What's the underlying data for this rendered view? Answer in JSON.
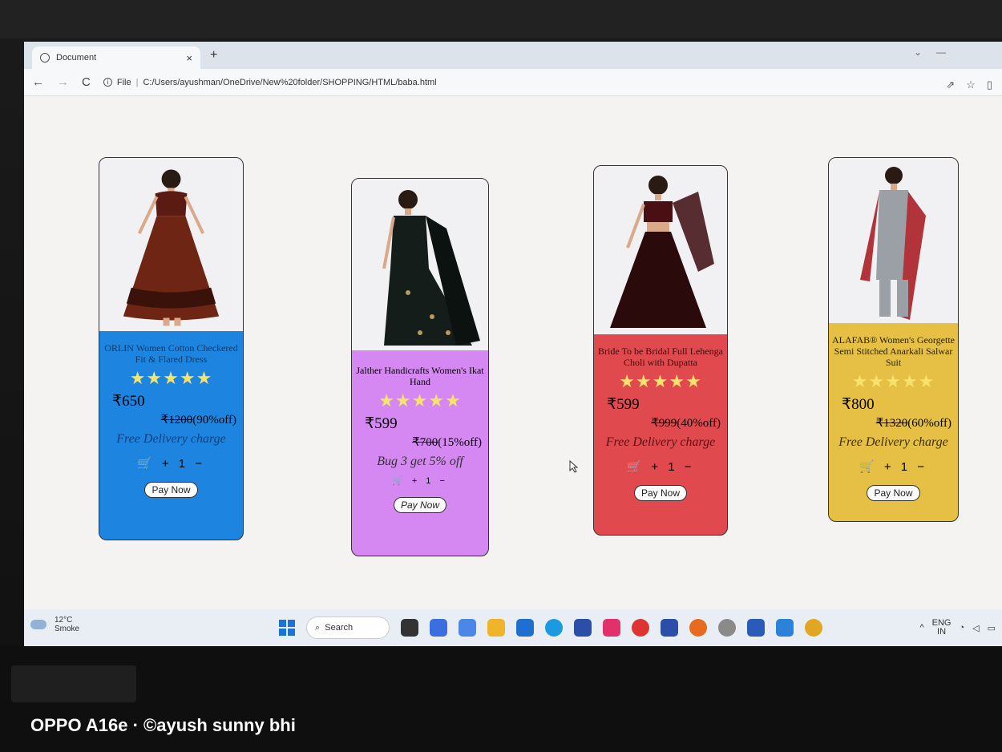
{
  "browser": {
    "tab_title": "Document",
    "tab_close": "×",
    "new_tab": "+",
    "nav": {
      "back": "←",
      "forward": "→",
      "reload": "C"
    },
    "url_prefix": "File",
    "url_sep": "|",
    "url": "C:/Users/ayushman/OneDrive/New%20folder/SHOPPING/HTML/baba.html",
    "actions": [
      "⇗",
      "☆",
      "▯"
    ]
  },
  "products": [
    {
      "name": "ORLIN Women Cotton Checkered Fit & Flared Dress",
      "stars": "★★★★★",
      "price": "₹650",
      "mrp": "₹1200",
      "off": "(90%off)",
      "note": "Free Delivery charge",
      "cart": "🛒 + 1 −",
      "pay": "Pay Now",
      "color": "#1d84e0",
      "image_icon": "flared-dress-icon"
    },
    {
      "name": "Jalther Handicrafts Women's Ikat Hand",
      "stars": "★★★★★",
      "price": "₹599",
      "mrp": "₹700",
      "off": "(15%off)",
      "note": "Bug 3 get 5% off",
      "cart": "🛒 + 1 −",
      "pay": "Pay Now",
      "color": "#d588f1",
      "image_icon": "saree-icon"
    },
    {
      "name": "Bride To be Bridal Full Lehenga Choli with Dupatta",
      "stars": "★★★★★",
      "price": "₹599",
      "mrp": "₹999",
      "off": "(40%off)",
      "note": "Free Delivery charge",
      "cart": "🛒 + 1 −",
      "pay": "Pay Now",
      "color": "#e04a4f",
      "image_icon": "lehenga-icon"
    },
    {
      "name": "ALAFAB® Women's Georgette Semi Stitched Anarkali Salwar Suit",
      "stars": "★★★★★",
      "price": "₹800",
      "mrp": "₹1320",
      "off": "(60%off)",
      "note": "Free Delivery charge",
      "cart": "🛒 + 1 −",
      "pay": "Pay Now",
      "color": "#e6c044",
      "image_icon": "salwar-suit-icon"
    }
  ],
  "taskbar": {
    "temp": "12°C",
    "weather": "Smoke",
    "search": "Search",
    "tray_lang": "ENG",
    "tray_region": "IN"
  },
  "watermark": "OPPO A16e · ©ayush sunny bhi"
}
